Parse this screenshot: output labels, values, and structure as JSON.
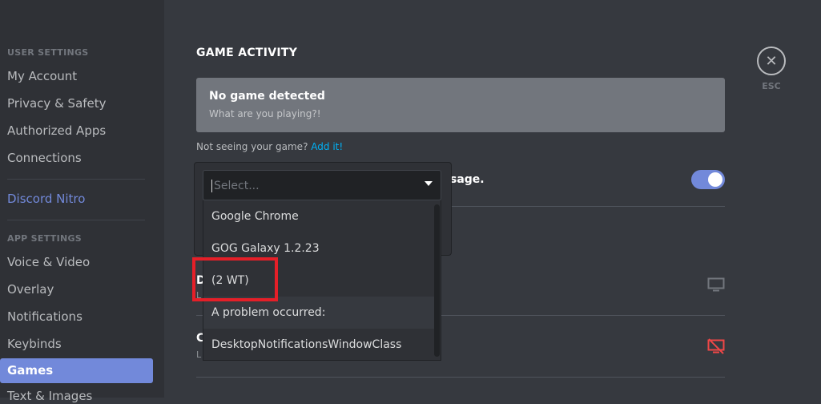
{
  "sidebar": {
    "user_header": "USER SETTINGS",
    "user_items": [
      "My Account",
      "Privacy & Safety",
      "Authorized Apps",
      "Connections"
    ],
    "nitro": "Discord Nitro",
    "app_header": "APP SETTINGS",
    "app_items": [
      "Voice & Video",
      "Overlay",
      "Notifications",
      "Keybinds",
      "Games",
      "Text & Images"
    ],
    "active_item": "Games",
    "active_color": "#7289da"
  },
  "main": {
    "title": "GAME ACTIVITY",
    "game_box": {
      "title": "No game detected",
      "subtitle": "What are you playing?!"
    },
    "not_seeing": "Not seeing your game?",
    "add_it": "Add it!",
    "status_row_suffix": "sage.",
    "row_partial_1": "D",
    "row_partial_2": "C",
    "row_sub_1": "L",
    "row_sub_2": "L",
    "toggle_on": true
  },
  "esc": {
    "label": "ESC",
    "icon": "close-icon"
  },
  "dropdown": {
    "placeholder": "Select...",
    "options": [
      "Google Chrome",
      "GOG Galaxy 1.2.23",
      "(2 WT)",
      "A problem occurred:",
      "DesktopNotificationsWindowClass"
    ],
    "hovered_index": 3
  },
  "colors": {
    "background": "#36393f",
    "sidebar": "#2f3136",
    "accent": "#7289da",
    "link": "#00b0f4",
    "danger": "#f04747",
    "highlight": "#e51f28"
  }
}
